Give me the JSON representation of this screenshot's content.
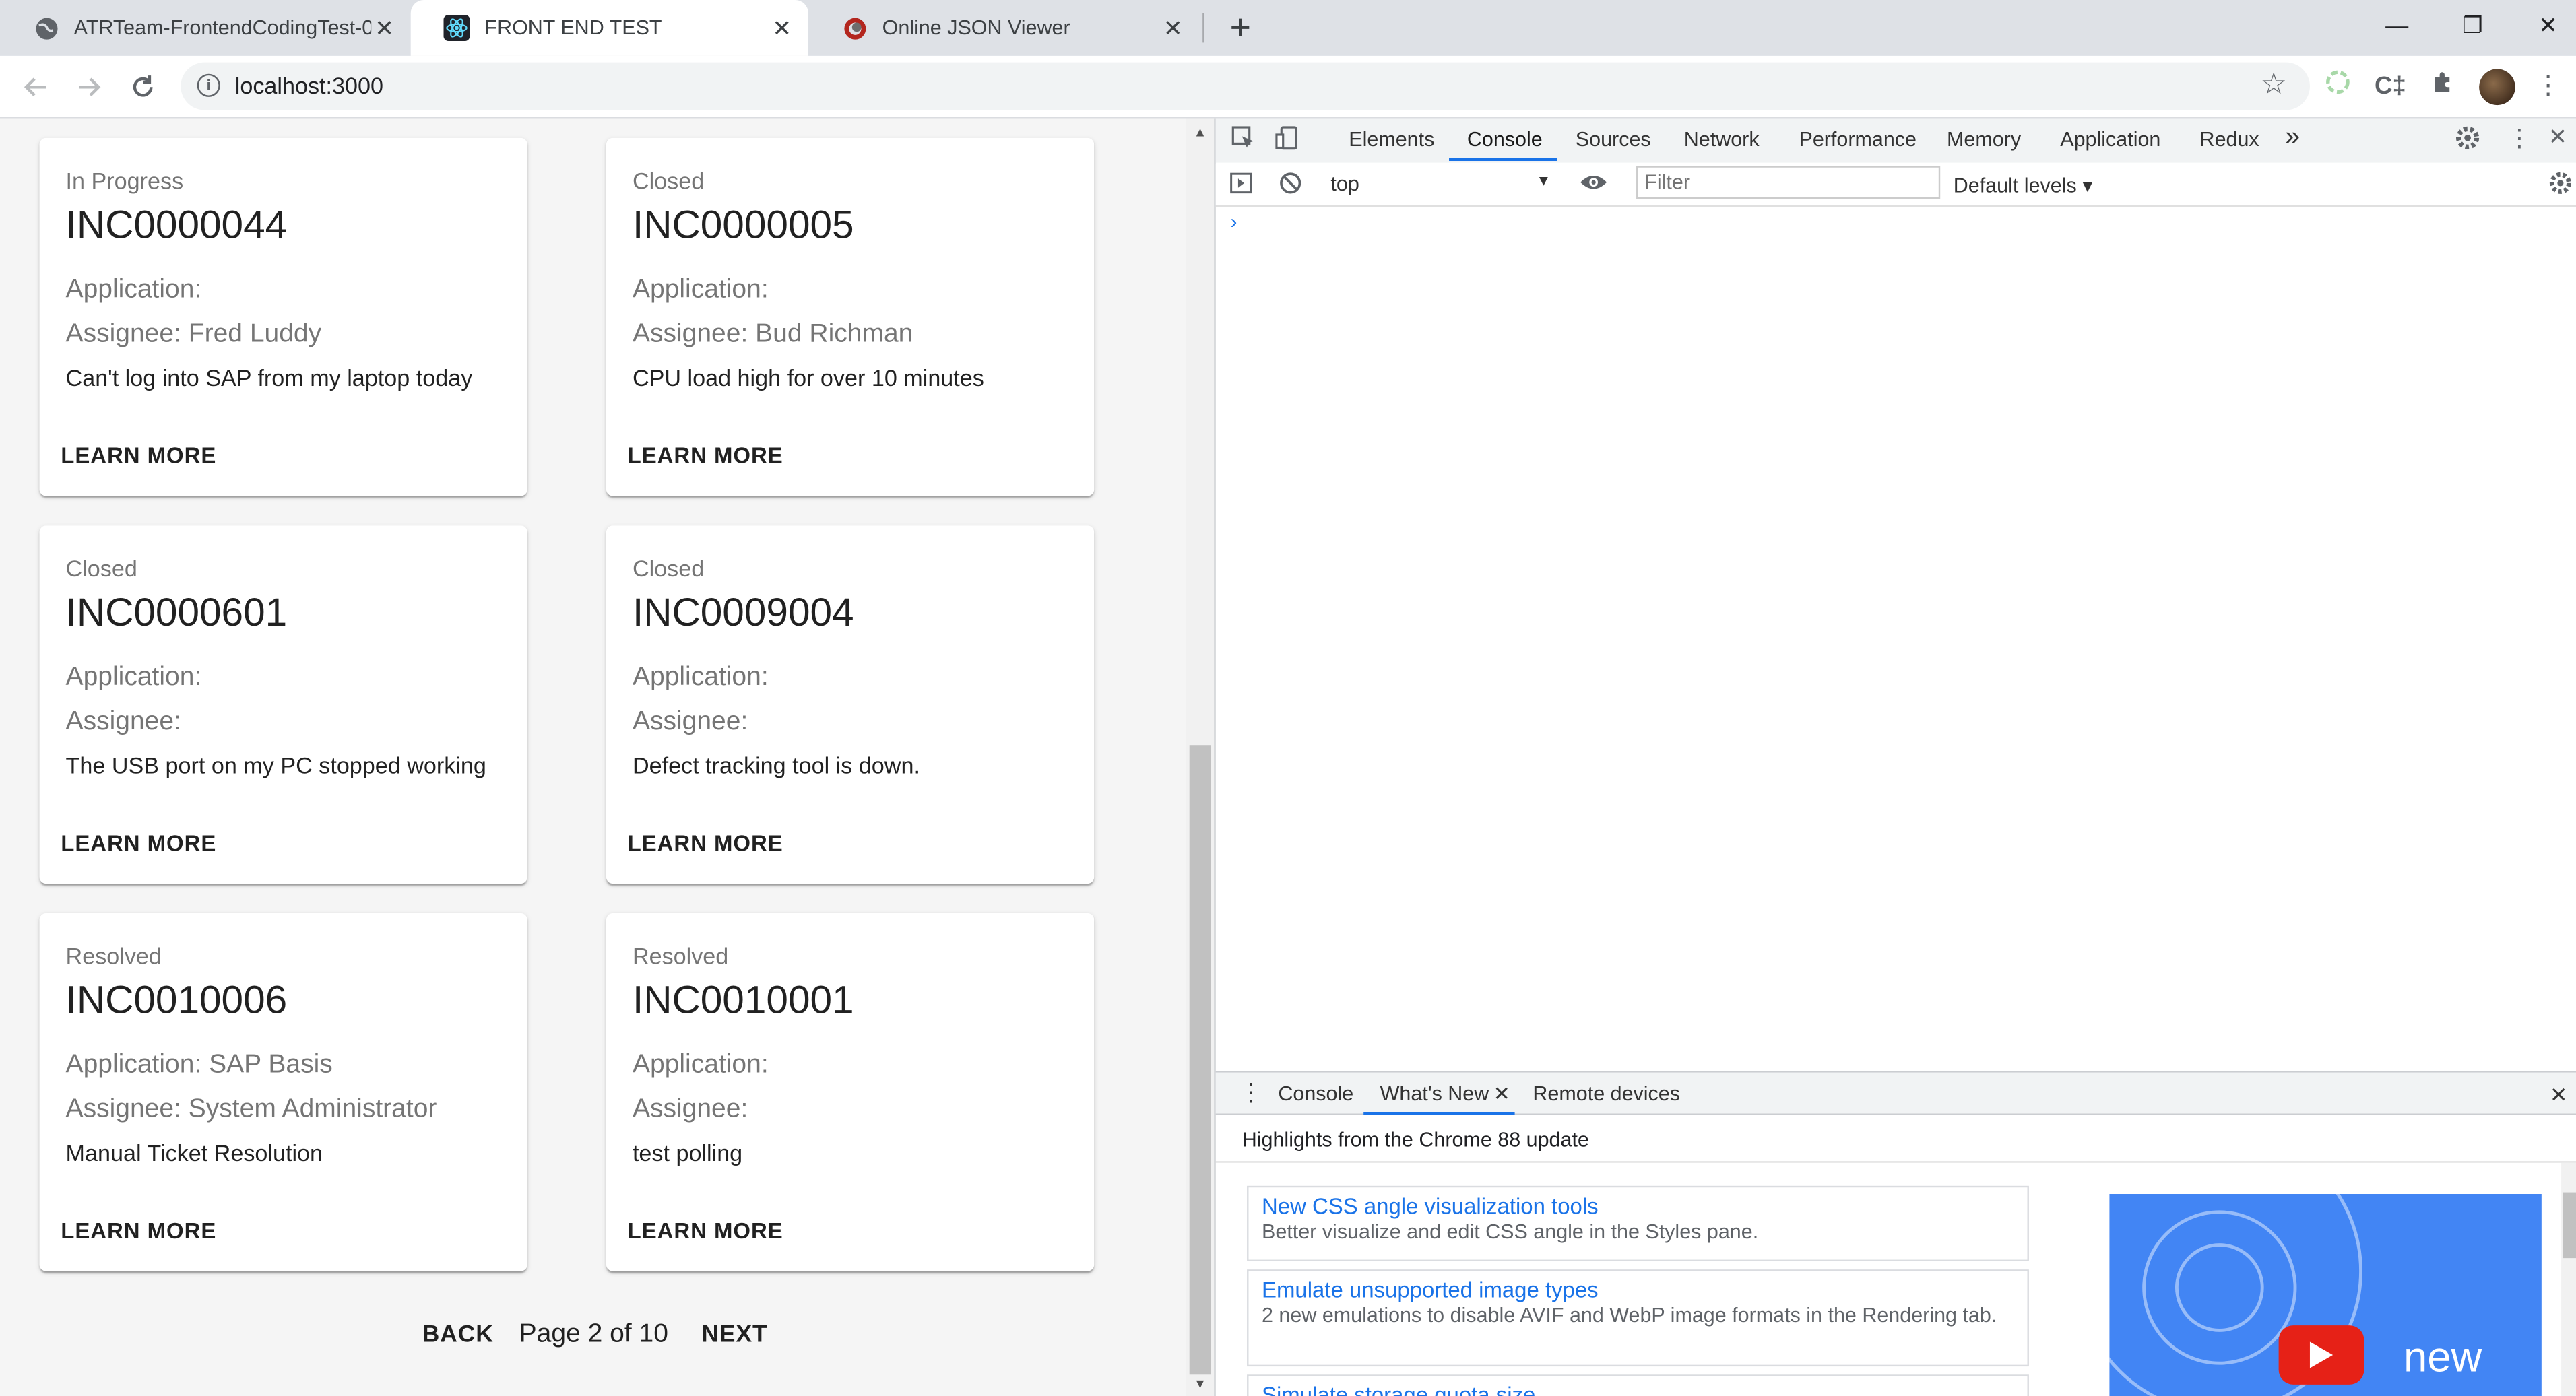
{
  "browser": {
    "tabs": [
      {
        "title": "ATRTeam-FrontendCodingTest-0:",
        "favicon": "globe-icon",
        "active": false
      },
      {
        "title": "FRONT END TEST",
        "favicon": "react-icon",
        "active": true
      },
      {
        "title": "Online JSON Viewer",
        "favicon": "json-viewer-icon",
        "active": false
      }
    ],
    "close_glyph": "✕",
    "new_tab_glyph": "+",
    "url": "localhost:3000",
    "window_controls": {
      "minimize": "—",
      "restore": "❐",
      "close": "✕"
    }
  },
  "incidents": [
    {
      "status": "In Progress",
      "number": "INC0000044",
      "application": "Application:",
      "assignee": "Assignee: Fred Luddy",
      "description": "Can't log into SAP from my laptop today",
      "action": "LEARN MORE"
    },
    {
      "status": "Closed",
      "number": "INC0000005",
      "application": "Application:",
      "assignee": "Assignee: Bud Richman",
      "description": "CPU load high for over 10 minutes",
      "action": "LEARN MORE"
    },
    {
      "status": "Closed",
      "number": "INC0000601",
      "application": "Application:",
      "assignee": "Assignee:",
      "description": "The USB port on my PC stopped working",
      "action": "LEARN MORE"
    },
    {
      "status": "Closed",
      "number": "INC0009004",
      "application": "Application:",
      "assignee": "Assignee:",
      "description": "Defect tracking tool is down.",
      "action": "LEARN MORE"
    },
    {
      "status": "Resolved",
      "number": "INC0010006",
      "application": "Application: SAP Basis",
      "assignee": "Assignee: System Administrator",
      "description": "Manual Ticket Resolution",
      "action": "LEARN MORE"
    },
    {
      "status": "Resolved",
      "number": "INC0010001",
      "application": "Application:",
      "assignee": "Assignee:",
      "description": "test polling",
      "action": "LEARN MORE"
    }
  ],
  "pagination": {
    "back": "BACK",
    "label": "Page 2 of 10",
    "next": "NEXT"
  },
  "devtools": {
    "tabs": [
      "Elements",
      "Console",
      "Sources",
      "Network",
      "Performance",
      "Memory",
      "Application",
      "Redux"
    ],
    "active_tab": "Console",
    "more_glyph": "»",
    "context": "top",
    "filter_placeholder": "Filter",
    "levels": "Default levels ▾",
    "prompt": "›",
    "drawer": {
      "tabs": [
        "Console",
        "What's New",
        "Remote devices"
      ],
      "active_tab": "What's New",
      "highlights": "Highlights from the Chrome 88 update",
      "features": [
        {
          "title": "New CSS angle visualization tools",
          "desc": "Better visualize and edit CSS angle in the Styles pane."
        },
        {
          "title": "Emulate unsupported image types",
          "desc": "2 new emulations to disable AVIF and WebP image formats in the Rendering tab."
        },
        {
          "title": "Simulate storage quota size",
          "desc": ""
        }
      ],
      "promo_text": "new"
    }
  }
}
